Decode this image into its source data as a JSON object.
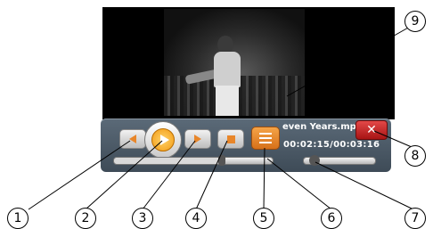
{
  "video": {
    "description_hidden": ""
  },
  "player": {
    "filename": "even Years.mpg",
    "time": "00:02:15/00:03:16",
    "seek_progress": 0.68,
    "volume_level": 0.08,
    "close_glyph": "✕"
  },
  "callouts": [
    "1",
    "2",
    "3",
    "4",
    "5",
    "6",
    "7",
    "8",
    "9"
  ],
  "colors": {
    "panel": "#4a5866",
    "accent": "#f39a13",
    "close": "#c62020"
  }
}
